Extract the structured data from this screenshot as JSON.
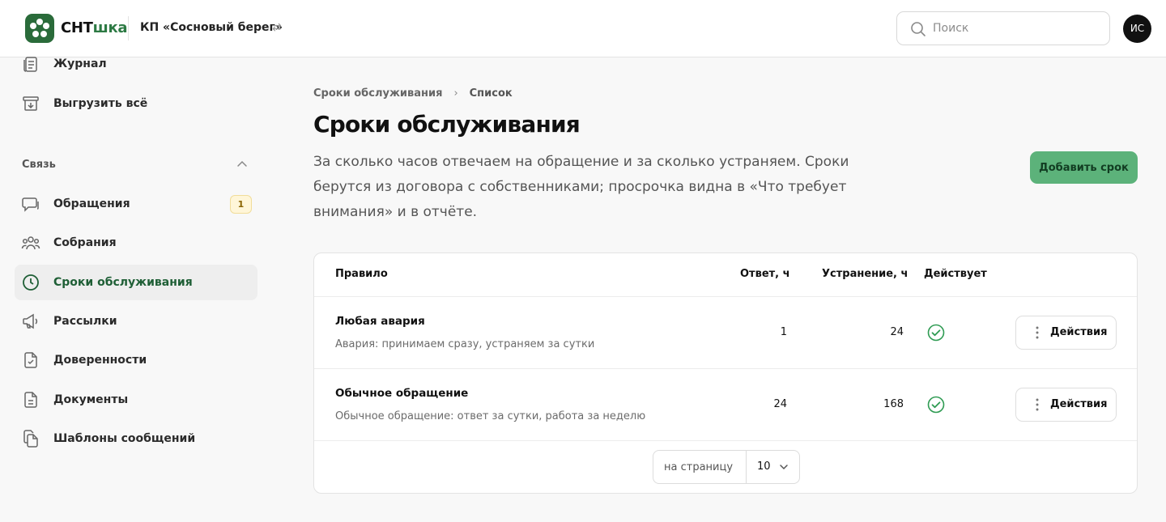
{
  "header": {
    "logo_main": "СНТ",
    "logo_accent": "шка",
    "org_name": "КП «Сосновый берег»",
    "swap_glyph": "⇄",
    "search_placeholder": "Поиск",
    "avatar_initials": "ИС"
  },
  "sidebar": {
    "items_top": [
      {
        "label": "Журнал",
        "icon": "journal-icon"
      },
      {
        "label": "Выгрузить всё",
        "icon": "archive-download-icon"
      }
    ],
    "section_label": "Связь",
    "items": [
      {
        "label": "Обращения",
        "icon": "chat-icon",
        "badge": "1"
      },
      {
        "label": "Собрания",
        "icon": "people-icon"
      },
      {
        "label": "Сроки обслуживания",
        "icon": "clock-icon",
        "active": true
      },
      {
        "label": "Рассылки",
        "icon": "megaphone-icon"
      },
      {
        "label": "Доверенности",
        "icon": "document-check-icon"
      },
      {
        "label": "Документы",
        "icon": "document-icon"
      },
      {
        "label": "Шаблоны сообщений",
        "icon": "copy-icon"
      }
    ]
  },
  "main": {
    "breadcrumb": [
      "Сроки обслуживания",
      "Список"
    ],
    "breadcrumb_sep": "›",
    "title": "Сроки обслуживания",
    "description": "За сколько часов отвечаем на обращение и за сколько устраняем. Сроки берутся из договора с собственниками; просрочка видна в «Что требует внимания» и в отчёте.",
    "add_button": "Добавить срок"
  },
  "table": {
    "columns": {
      "rule": "Правило",
      "response": "Ответ, ч",
      "fix": "Устранение, ч",
      "active": "Действует"
    },
    "rows": [
      {
        "title": "Любая авария",
        "subtitle": "Авария: принимаем сразу, устраняем за сутки",
        "response": "1",
        "fix": "24",
        "active": true,
        "action": "Действия"
      },
      {
        "title": "Обычное обращение",
        "subtitle": "Обычное обращение: ответ за сутки, работа за неделю",
        "response": "24",
        "fix": "168",
        "active": true,
        "action": "Действия"
      }
    ],
    "pager": {
      "label": "на страницу",
      "value": "10"
    }
  },
  "colors": {
    "brand": "#2a6b3a",
    "accent_button": "#5cb27a",
    "check": "#2e9b52"
  }
}
